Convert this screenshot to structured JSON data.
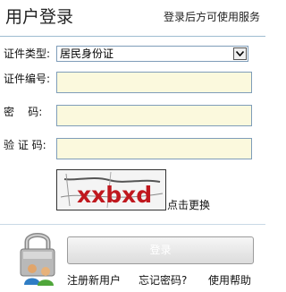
{
  "header": {
    "title": "用户登录",
    "subtitle": "登录后方可使用服务"
  },
  "form": {
    "id_type_label": "证件类型:",
    "id_type_selected": "居民身份证",
    "id_number_label": "证件编号:",
    "id_number_value": "",
    "password_label": "密    码:",
    "password_value": "",
    "captcha_label": "验 证 码:",
    "captcha_value": "",
    "captcha_image_text": "xxbxd",
    "captcha_refresh": "点击更换"
  },
  "actions": {
    "login_label": "登录",
    "register_label": "注册新用户",
    "forgot_label": "忘记密码?",
    "help_label": "使用帮助"
  },
  "icons": {
    "select_arrow": "chevron-down-icon",
    "lock": "lock-user-icon"
  },
  "colors": {
    "input_background": "#fbf9dd",
    "input_border": "#7f9db9",
    "header_line": "#9fbcd0",
    "captcha_text": "#c0181e"
  }
}
